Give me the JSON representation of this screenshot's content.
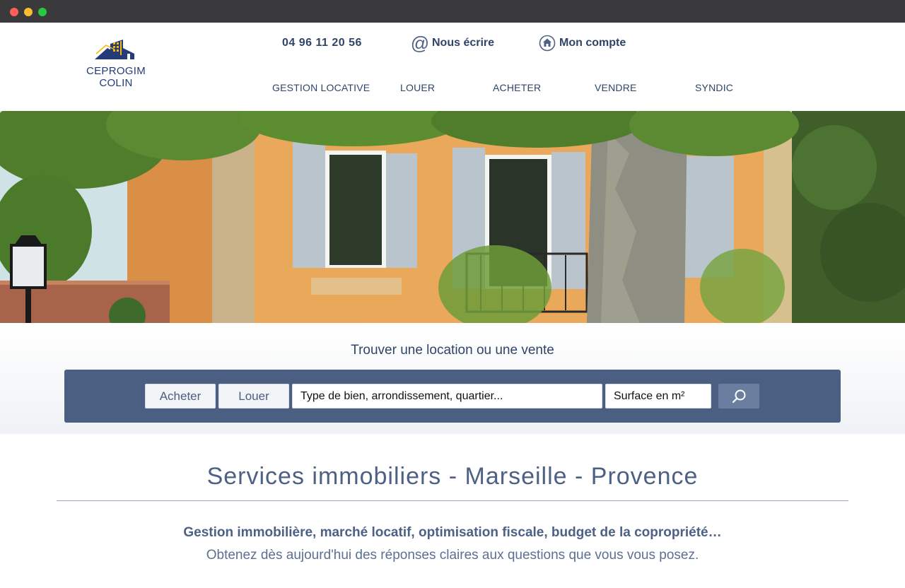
{
  "header": {
    "logo": {
      "line1": "CEPROGIM",
      "line2": "COLIN"
    },
    "phone": "04 96 11 20 56",
    "write_label": "Nous écrire",
    "account_label": "Mon compte",
    "nav": [
      "GESTION LOCATIVE",
      "LOUER",
      "ACHETER",
      "VENDRE",
      "SYNDIC"
    ]
  },
  "search": {
    "title": "Trouver une location ou une vente",
    "buy_label": "Acheter",
    "rent_label": "Louer",
    "type_placeholder": "Type de bien, arrondissement, quartier...",
    "surface_placeholder": "Surface en m²"
  },
  "services": {
    "title": "Services immobiliers - Marseille - Provence",
    "lead": "Gestion immobilière, marché locatif, optimisation fiscale, budget de la copropriété…",
    "sub": "Obtenez dès aujourd'hui des réponses claires aux questions que vous vous posez."
  },
  "colors": {
    "brand_navy": "#2f4468",
    "search_panel": "#4b5f82",
    "search_button": "#6b7ea0",
    "logo_gold": "#f2b705"
  },
  "icons": [
    "at-icon",
    "home-circle-icon",
    "search-icon",
    "logo-building-icon"
  ]
}
